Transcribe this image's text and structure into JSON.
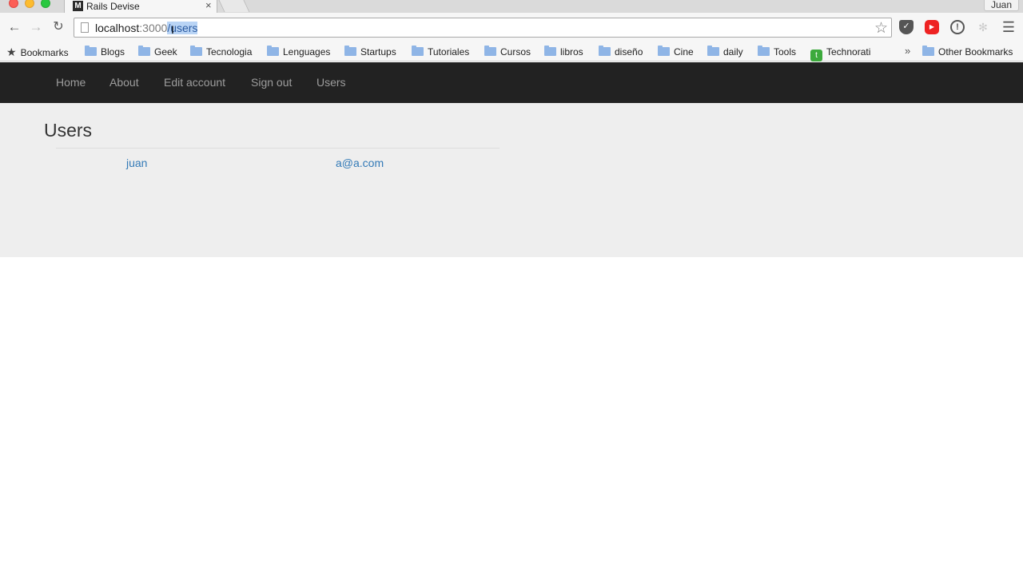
{
  "browser": {
    "tab_title": "Rails Devise",
    "tab_favicon": "M",
    "tab_close": "×",
    "profile_name": "Juan",
    "address": {
      "host": "localhost",
      "port": ":3000",
      "path": "/users"
    },
    "bookmarks": [
      {
        "label": "Bookmarks",
        "icon": "star-icon"
      },
      {
        "label": "Blogs",
        "icon": "folder-icon"
      },
      {
        "label": "Geek",
        "icon": "folder-icon"
      },
      {
        "label": "Tecnologia",
        "icon": "folder-icon"
      },
      {
        "label": "Lenguages",
        "icon": "folder-icon"
      },
      {
        "label": "Startups",
        "icon": "folder-icon"
      },
      {
        "label": "Tutoriales",
        "icon": "folder-icon"
      },
      {
        "label": "Cursos",
        "icon": "folder-icon"
      },
      {
        "label": "libros",
        "icon": "folder-icon"
      },
      {
        "label": "diseño",
        "icon": "folder-icon"
      },
      {
        "label": "Cine",
        "icon": "folder-icon"
      },
      {
        "label": "daily",
        "icon": "folder-icon"
      },
      {
        "label": "Tools",
        "icon": "folder-icon"
      },
      {
        "label": "Technorati",
        "icon": "technorati-icon"
      }
    ],
    "bookmarks_overflow": "»",
    "other_bookmarks": "Other Bookmarks"
  },
  "navbar": {
    "links": [
      "Home",
      "About",
      "Edit account",
      "Sign out",
      "Users"
    ]
  },
  "page": {
    "title": "Users",
    "users": [
      {
        "name": "juan",
        "email": "a@a.com"
      }
    ]
  },
  "colors": {
    "navbar_bg": "#222222",
    "nav_link": "#9d9d9d",
    "content_bg": "#eeeeee",
    "link": "#337ab7"
  }
}
